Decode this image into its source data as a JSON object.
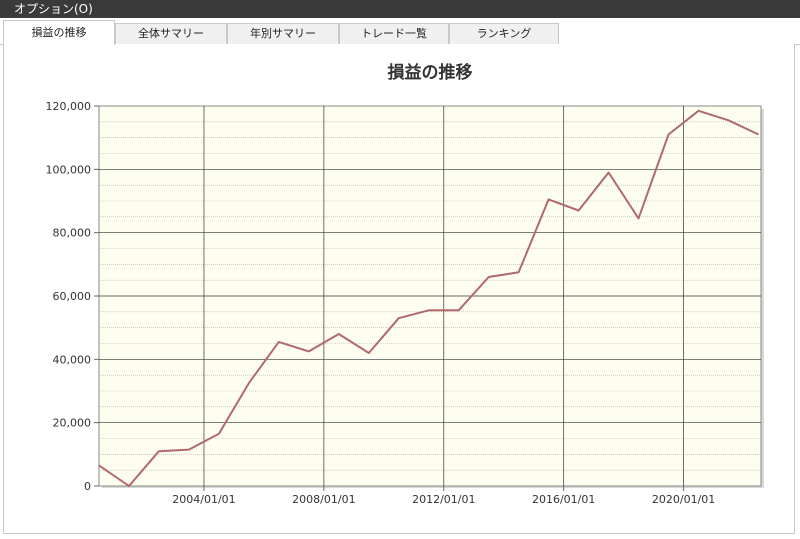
{
  "window": {
    "title": "オプション(O)"
  },
  "tabs": [
    {
      "label": "損益の推移",
      "active": true
    },
    {
      "label": "全体サマリー",
      "active": false
    },
    {
      "label": "年別サマリー",
      "active": false
    },
    {
      "label": "トレード一覧",
      "active": false
    },
    {
      "label": "ランキング",
      "active": false
    }
  ],
  "colors": {
    "plot_background": "#fefef0",
    "line": "#b06a6a",
    "grid_major": "#333333",
    "grid_minor": "#b0b0a0"
  },
  "chart_data": {
    "type": "line",
    "title": "損益の推移",
    "xlabel": "",
    "ylabel": "",
    "x": [
      "2000/07/01",
      "2001/07/01",
      "2002/07/01",
      "2003/07/01",
      "2004/07/01",
      "2005/07/01",
      "2006/07/01",
      "2007/07/01",
      "2008/07/01",
      "2009/07/01",
      "2010/07/01",
      "2011/07/01",
      "2012/07/01",
      "2013/07/01",
      "2014/07/01",
      "2015/07/01",
      "2016/07/01",
      "2017/07/01",
      "2018/07/01",
      "2019/07/01",
      "2020/07/01",
      "2021/07/01",
      "2022/07/01"
    ],
    "y": [
      6500,
      0,
      11000,
      11500,
      16500,
      32500,
      45500,
      42500,
      48000,
      42000,
      53000,
      55500,
      55500,
      66000,
      67500,
      90500,
      87000,
      99000,
      84500,
      111000,
      118500,
      115500,
      111000
    ],
    "xlim": [
      "2000/07/01",
      "2022/08/01"
    ],
    "ylim": [
      0,
      120000
    ],
    "xticks": [
      "2004/01/01",
      "2008/01/01",
      "2012/01/01",
      "2016/01/01",
      "2020/01/01"
    ],
    "yticks": [
      0,
      20000,
      40000,
      60000,
      80000,
      100000,
      120000
    ],
    "ytick_labels": [
      "0",
      "20,000",
      "40,000",
      "60,000",
      "80,000",
      "100,000",
      "120,000"
    ],
    "minor_grid_step": 5000,
    "grid": true,
    "legend": "none"
  }
}
